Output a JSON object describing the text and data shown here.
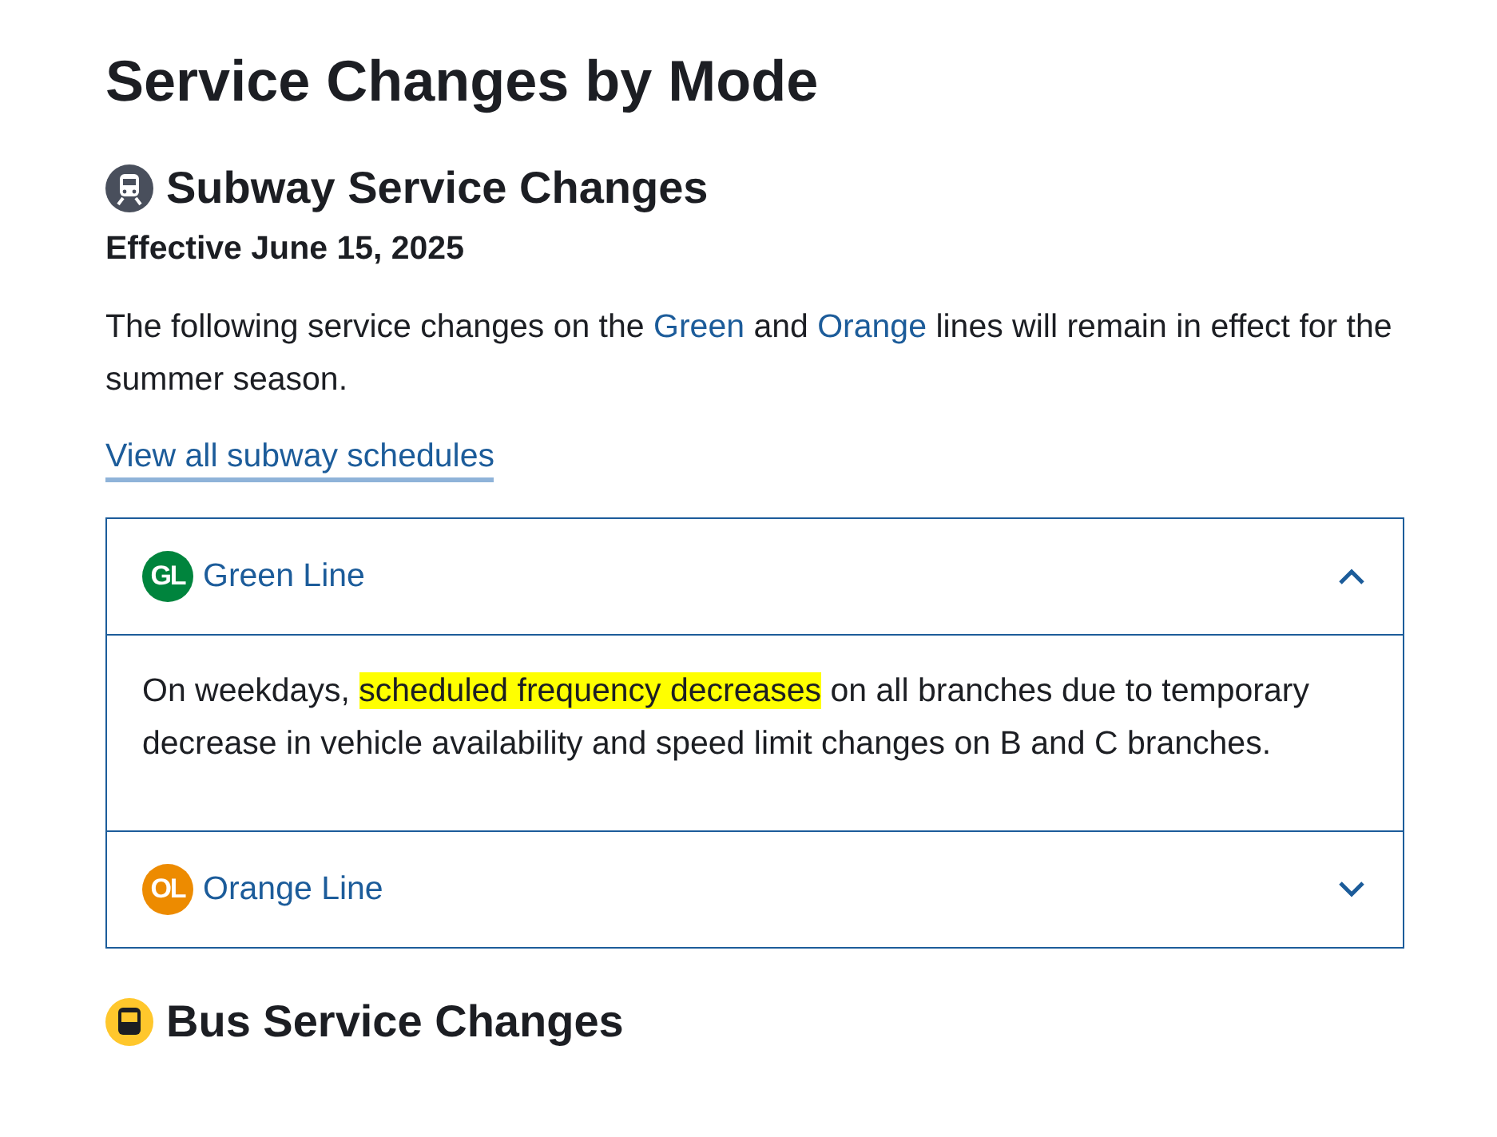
{
  "title": "Service Changes by Mode",
  "sections": [
    {
      "kind": "subway",
      "heading": "Subway Service Changes",
      "effective": "Effective June 15, 2025",
      "intro": [
        {
          "kind": "text",
          "text": "The following service changes on the "
        },
        {
          "kind": "link",
          "text": "Green"
        },
        {
          "kind": "text",
          "text": " and "
        },
        {
          "kind": "link",
          "text": "Orange"
        },
        {
          "kind": "text",
          "text": " lines will remain in effect for the summer season."
        }
      ],
      "link": "View all subway schedules",
      "lines": [
        {
          "badge": "GL",
          "color": "#00843d",
          "name": "Green Line",
          "expanded": true,
          "body": [
            {
              "text": "On weekdays, ",
              "highlighted": false
            },
            {
              "text": "scheduled frequency decreases",
              "highlighted": true
            },
            {
              "text": " on all branches due to temporary decrease in vehicle availability and speed limit changes on B and C branches.",
              "highlighted": false
            }
          ]
        },
        {
          "badge": "OL",
          "color": "#ed8b00",
          "name": "Orange Line",
          "expanded": false
        }
      ]
    },
    {
      "kind": "bus",
      "heading": "Bus Service Changes"
    }
  ]
}
